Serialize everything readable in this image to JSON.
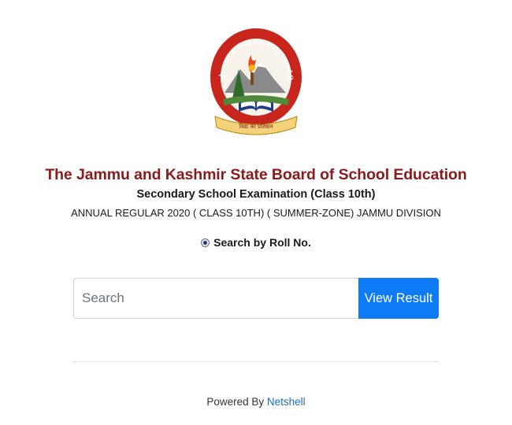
{
  "logo": {
    "seal_text": "Jammu & Kashmir State Board Of School Education",
    "motto": "विद्या का प्रतिष्ठान"
  },
  "header": {
    "board_title": "The Jammu and Kashmir State Board of School Education",
    "exam_title": "Secondary School Examination (Class 10th)",
    "session_title": "ANNUAL REGULAR 2020 ( CLASS 10TH) ( SUMMER-ZONE) JAMMU DIVISION"
  },
  "search_mode": {
    "label": "Search by Roll No.",
    "selected": true
  },
  "search": {
    "placeholder": "Search",
    "value": "",
    "button_label": "View Result"
  },
  "footer": {
    "prefix": "Powered By",
    "link_text": "Netshell"
  },
  "colors": {
    "title": "#8b1a1a",
    "button": "#0d7bf5",
    "link": "#1a6fc4"
  }
}
